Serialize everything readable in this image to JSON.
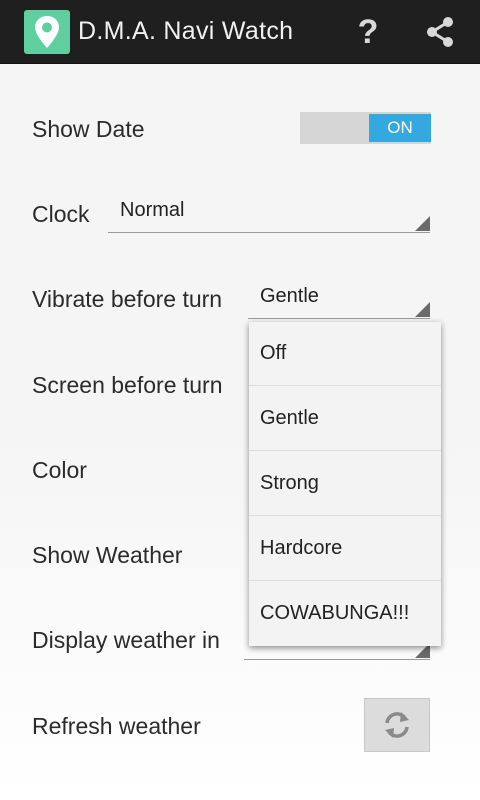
{
  "app": {
    "title": "D.M.A. Navi Watch",
    "icon": "map-pin-icon",
    "actions": [
      {
        "name": "help",
        "icon": "question-mark-icon",
        "glyph": "?"
      },
      {
        "name": "share",
        "icon": "share-icon"
      }
    ]
  },
  "settings": {
    "show_date": {
      "label": "Show Date",
      "switch_state": "ON"
    },
    "clock": {
      "label": "Clock",
      "value": "Normal"
    },
    "vibrate": {
      "label": "Vibrate before turn",
      "value": "Gentle"
    },
    "screen": {
      "label": "Screen before turn"
    },
    "color": {
      "label": "Color"
    },
    "show_weather": {
      "label": "Show Weather"
    },
    "display_weather": {
      "label": "Display weather in"
    },
    "refresh_weather": {
      "label": "Refresh weather",
      "icon": "refresh-icon"
    }
  },
  "dropdown": {
    "options": [
      "Off",
      "Gentle",
      "Strong",
      "Hardcore",
      "COWABUNGA!!!"
    ]
  },
  "colors": {
    "action_bar": "#1f1f1f",
    "app_icon": "#5fcf9f",
    "switch_on": "#33a9e0"
  }
}
